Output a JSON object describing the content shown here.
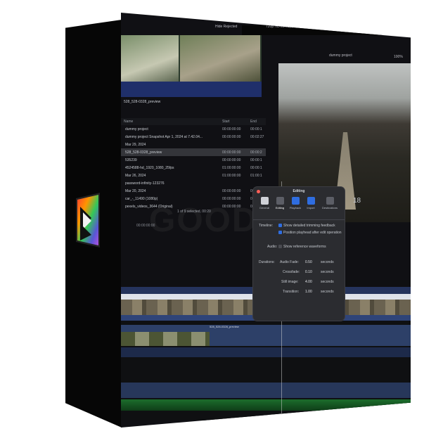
{
  "topbar": {
    "hide_rejected": "Hide Rejected",
    "format": "720p HD 23.98p, Stereo",
    "project": "dummy project",
    "zoom": "100%"
  },
  "browser": {
    "clip_name": "528_528-0328_preview",
    "columns": {
      "name": "Name",
      "start": "Start",
      "end": "End"
    },
    "rows": [
      {
        "name": "dummy project",
        "start": "00:00:00:00",
        "end": "00:00:1",
        "selected": false
      },
      {
        "name": "dummy project Snapshot Apr 1, 2024 at 7.42.04...",
        "start": "00:00:00:00",
        "end": "00:02:27",
        "selected": false
      },
      {
        "name": "Mar 29, 2024",
        "start": "",
        "end": "",
        "selected": false
      },
      {
        "name": "528_528-0328_preview",
        "start": "00:00:00:00",
        "end": "00:00:2",
        "selected": true
      },
      {
        "name": "535239",
        "start": "00:00:00:00",
        "end": "00:00:1",
        "selected": false
      },
      {
        "name": "4524588-hd_1920_1080_25fps",
        "start": "01:00:00:00",
        "end": "00:00:1",
        "selected": false
      },
      {
        "name": "Mar 26, 2024",
        "start": "01:00:00:00",
        "end": "01:00:1",
        "selected": false
      },
      {
        "name": "password-infinity-123276",
        "start": "",
        "end": "",
        "selected": false
      },
      {
        "name": "Mar 20, 2024",
        "start": "00:00:00:00",
        "end": "00:02:25",
        "selected": false
      },
      {
        "name": "car_-_11490 (1080p)",
        "start": "00:00:00:00",
        "end": "00:00:3",
        "selected": false
      },
      {
        "name": "pexels_videos_3644 (Original)",
        "start": "00:00:00:00",
        "end": "00:00:1",
        "selected": false
      }
    ],
    "selection_status": "1 of 9 selected, 00:20",
    "timecode": "00:00:00:00"
  },
  "dialog": {
    "title": "Editing",
    "tabs": [
      "General",
      "Editing",
      "Playback",
      "Import",
      "Destinations"
    ],
    "timeline_label": "Timeline:",
    "opt_detailed_trim": "Show detailed trimming feedback",
    "opt_position_playhead": "Position playhead after edit operation",
    "audio_label": "Audio:",
    "opt_reference_waveforms": "Show reference waveforms",
    "durations_label": "Durations:",
    "fields": [
      {
        "label": "Audio Fade:",
        "value": "0.50",
        "unit": "seconds"
      },
      {
        "label": "Crossfade:",
        "value": "0.10",
        "unit": "seconds"
      },
      {
        "label": "Still image:",
        "value": "4.00",
        "unit": "seconds"
      },
      {
        "label": "Transition:",
        "value": "1.00",
        "unit": "seconds"
      }
    ],
    "viewer_timecode": "18"
  },
  "timeline": {
    "clip_label": "528_528-0328_preview"
  },
  "colors": {
    "accent": "#2f6de0",
    "panel": "#2b2c30",
    "box": "#101014"
  }
}
